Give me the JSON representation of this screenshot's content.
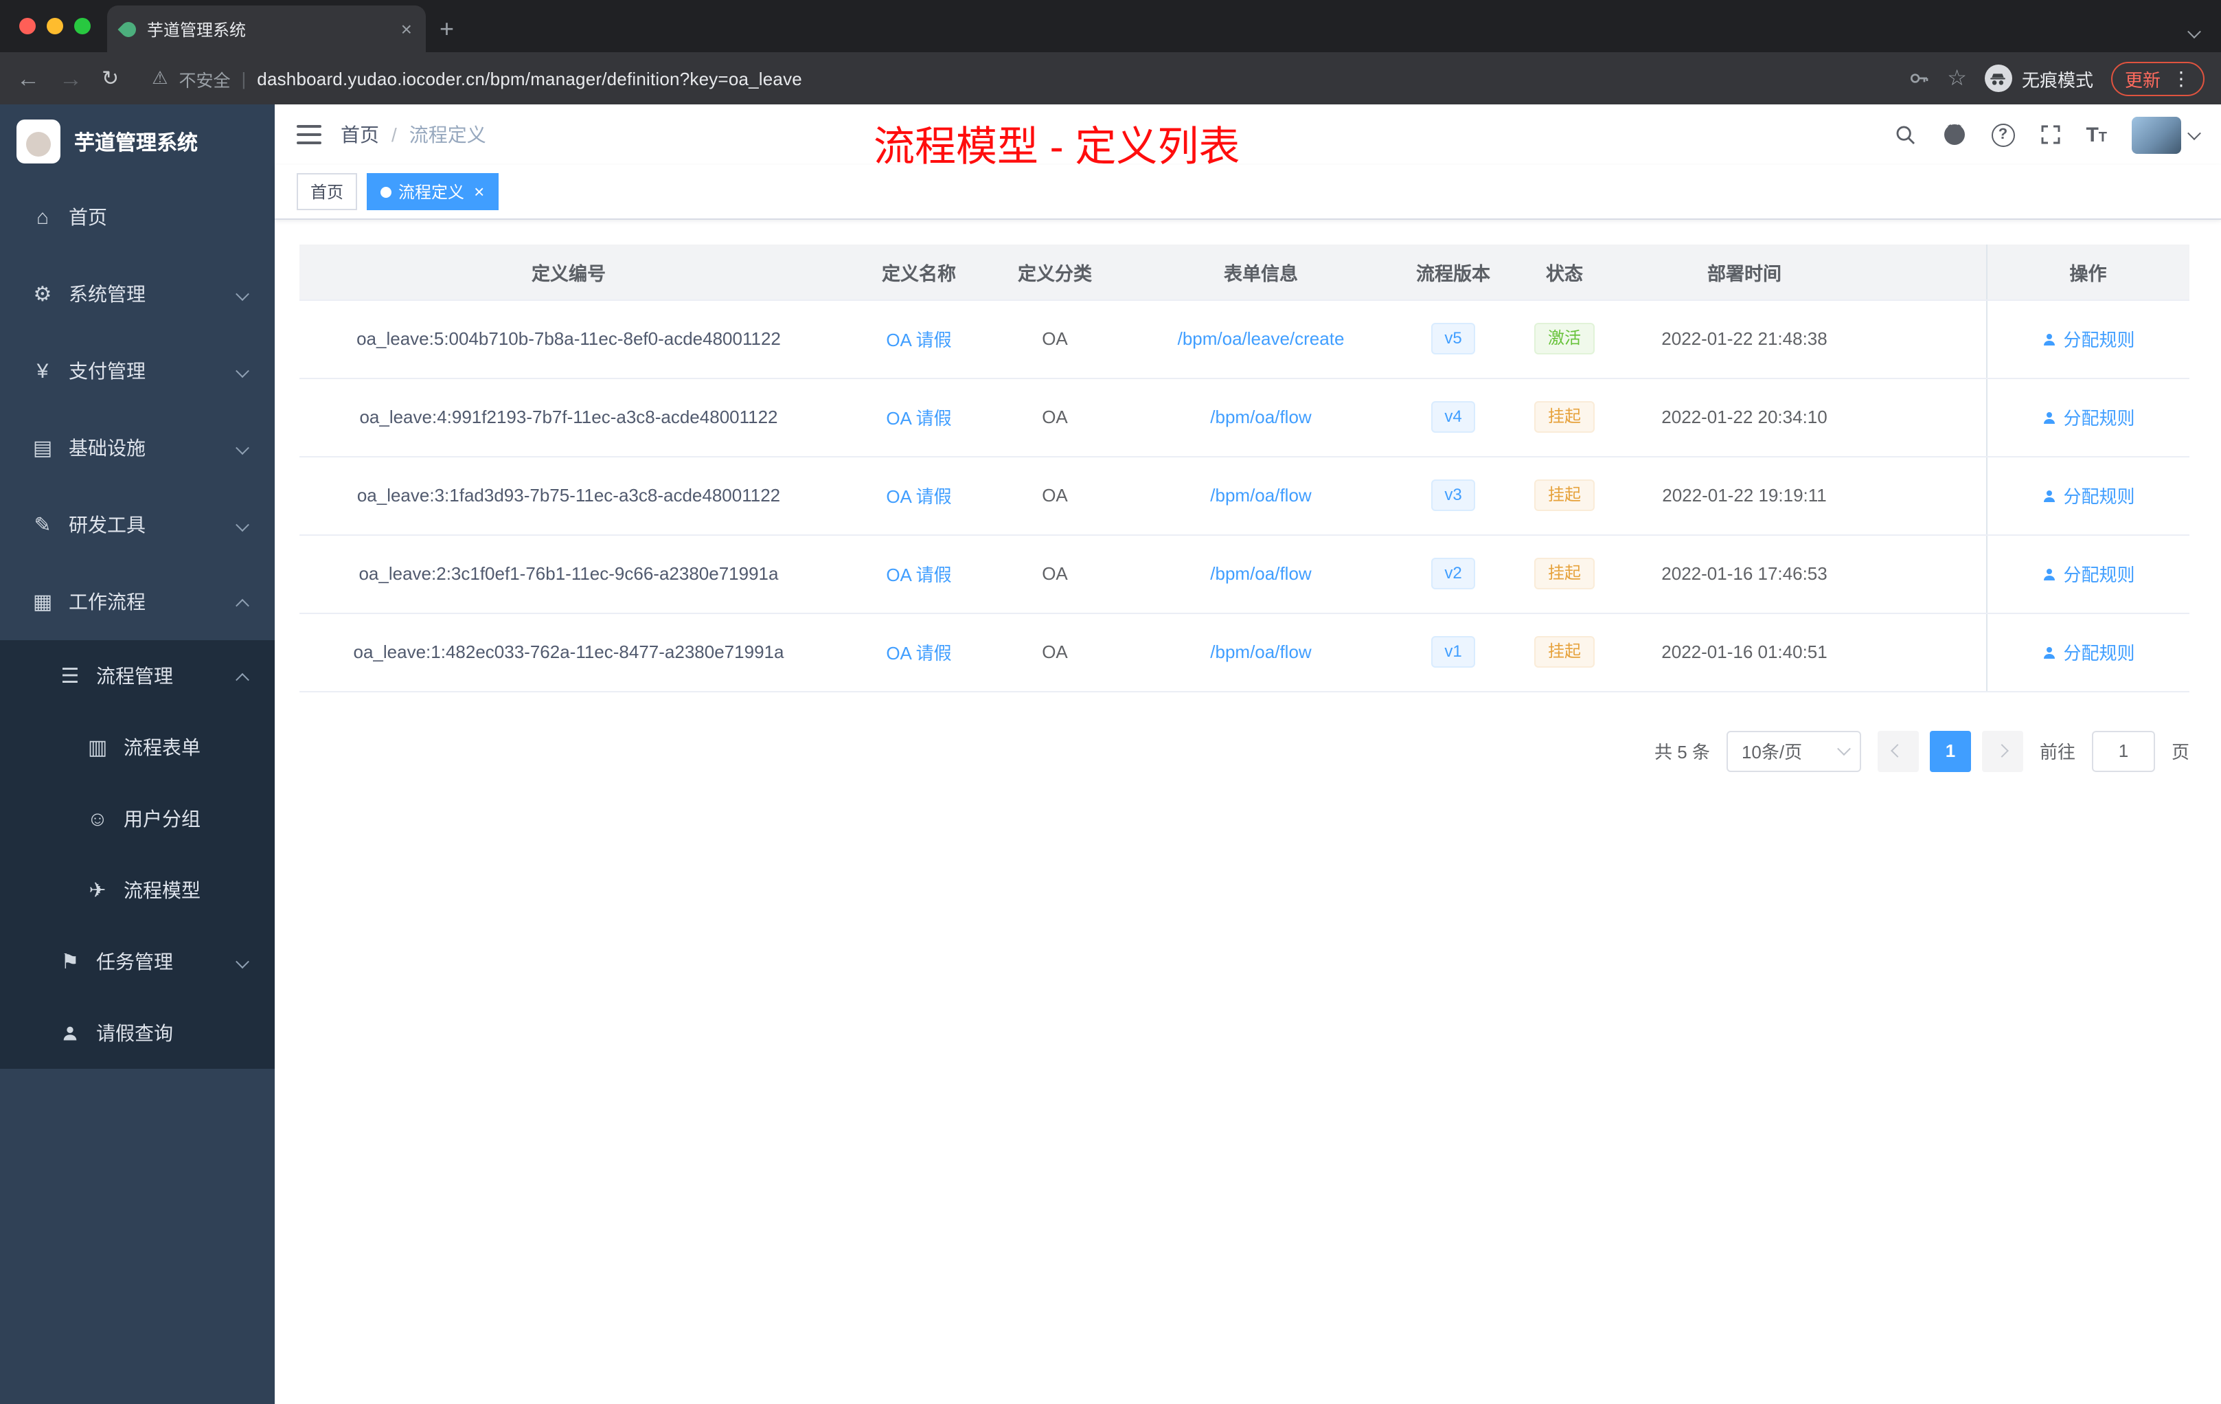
{
  "browser": {
    "tab_title": "芋道管理系统",
    "new_tab": "+",
    "security_label": "不安全",
    "url": "dashboard.yudao.iocoder.cn/bpm/manager/definition?key=oa_leave",
    "incognito_label": "无痕模式",
    "update_label": "更新"
  },
  "icons": {
    "home": "⌂",
    "system": "⚙",
    "payment": "¥",
    "infra": "▤",
    "devtools": "✎",
    "workflow": "▦",
    "process": "☰",
    "form": "▥",
    "group": "☺",
    "model": "✈",
    "task": "⚑"
  },
  "sidebar": {
    "logo_title": "芋道管理系统",
    "items": [
      {
        "label": "首页"
      },
      {
        "label": "系统管理"
      },
      {
        "label": "支付管理"
      },
      {
        "label": "基础设施"
      },
      {
        "label": "研发工具"
      },
      {
        "label": "工作流程"
      },
      {
        "label": "流程管理"
      },
      {
        "label": "流程表单"
      },
      {
        "label": "用户分组"
      },
      {
        "label": "流程模型"
      },
      {
        "label": "任务管理"
      },
      {
        "label": "请假查询"
      }
    ]
  },
  "header": {
    "breadcrumb_home": "首页",
    "breadcrumb_separator": "/",
    "breadcrumb_current": "流程定义",
    "overlay_title": "流程模型 - 定义列表"
  },
  "tags": {
    "home": "首页",
    "active": "流程定义",
    "close": "×"
  },
  "table": {
    "columns": [
      "定义编号",
      "定义名称",
      "定义分类",
      "表单信息",
      "流程版本",
      "状态",
      "部署时间",
      "操作"
    ],
    "rows": [
      {
        "id": "oa_leave:5:004b710b-7b8a-11ec-8ef0-acde48001122",
        "name": "OA 请假",
        "category": "OA",
        "form": "/bpm/oa/leave/create",
        "version": "v5",
        "status": "激活",
        "status_type": "success",
        "deploy_time": "2022-01-22 21:48:38",
        "action": "分配规则"
      },
      {
        "id": "oa_leave:4:991f2193-7b7f-11ec-a3c8-acde48001122",
        "name": "OA 请假",
        "category": "OA",
        "form": "/bpm/oa/flow",
        "version": "v4",
        "status": "挂起",
        "status_type": "warning",
        "deploy_time": "2022-01-22 20:34:10",
        "action": "分配规则"
      },
      {
        "id": "oa_leave:3:1fad3d93-7b75-11ec-a3c8-acde48001122",
        "name": "OA 请假",
        "category": "OA",
        "form": "/bpm/oa/flow",
        "version": "v3",
        "status": "挂起",
        "status_type": "warning",
        "deploy_time": "2022-01-22 19:19:11",
        "action": "分配规则"
      },
      {
        "id": "oa_leave:2:3c1f0ef1-76b1-11ec-9c66-a2380e71991a",
        "name": "OA 请假",
        "category": "OA",
        "form": "/bpm/oa/flow",
        "version": "v2",
        "status": "挂起",
        "status_type": "warning",
        "deploy_time": "2022-01-16 17:46:53",
        "action": "分配规则"
      },
      {
        "id": "oa_leave:1:482ec033-762a-11ec-8477-a2380e71991a",
        "name": "OA 请假",
        "category": "OA",
        "form": "/bpm/oa/flow",
        "version": "v1",
        "status": "挂起",
        "status_type": "warning",
        "deploy_time": "2022-01-16 01:40:51",
        "action": "分配规则"
      }
    ]
  },
  "pagination": {
    "total": "共 5 条",
    "page_size": "10条/页",
    "current_page": "1",
    "goto_label": "前往",
    "goto_value": "1",
    "page_unit": "页"
  }
}
